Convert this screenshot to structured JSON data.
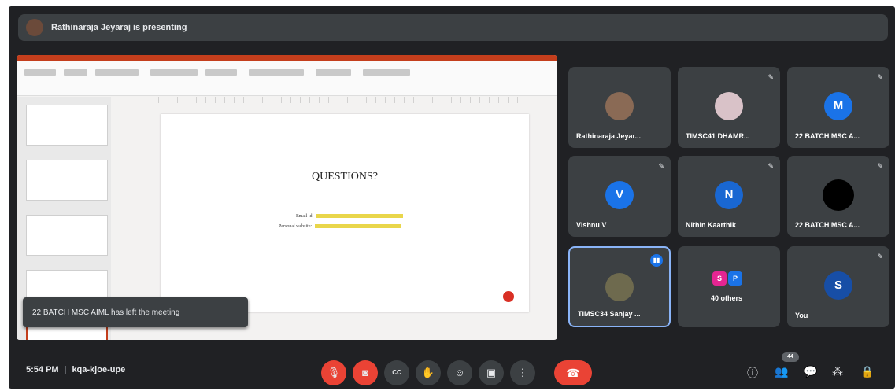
{
  "banner": {
    "text": "Rathinaraja Jeyaraj is presenting"
  },
  "presentation": {
    "slide_title": "QUESTIONS?",
    "line1_label": "Email id:",
    "line2_label": "Personal website:"
  },
  "toast": {
    "text": "22 BATCH MSC AIML has left the meeting"
  },
  "tiles": [
    {
      "name": "Rathinaraja Jeyar...",
      "avatar": "photo",
      "mic": ""
    },
    {
      "name": "TIMSC41 DHAMR...",
      "avatar": "photo",
      "mic": "muted-mic-icon"
    },
    {
      "name": "22 BATCH MSC A...",
      "avatar": "M",
      "color": "#1a73e8",
      "mic": "muted-mic-icon"
    },
    {
      "name": "Vishnu V",
      "avatar": "V",
      "color": "#1a73e8",
      "mic": "muted-mic-icon"
    },
    {
      "name": "Nithin Kaarthik",
      "avatar": "N",
      "color": "#1967d2",
      "mic": "muted-mic-icon"
    },
    {
      "name": "22 BATCH MSC A...",
      "avatar": "dark",
      "color": "#000000",
      "mic": "muted-mic-icon"
    },
    {
      "name": "TIMSC34 Sanjay ...",
      "avatar": "photo",
      "mic": "speaking-icon",
      "active": true
    },
    {
      "name": "40 others",
      "avatar": "S P",
      "mic": ""
    },
    {
      "name": "You",
      "avatar": "S",
      "color": "#174ea6",
      "mic": "muted-mic-icon"
    }
  ],
  "others_avatars": [
    {
      "letter": "S",
      "color": "#e52592"
    },
    {
      "letter": "P",
      "color": "#1a73e8"
    }
  ],
  "bottom": {
    "time": "5:54 PM",
    "meeting_code": "kqa-kjoe-upe",
    "people_count": "44"
  },
  "controls": {
    "mic": "mic-off-icon",
    "camera": "camera-off-icon",
    "captions": "CC",
    "raise_hand": "✋",
    "emoji": "☺",
    "present": "▣",
    "more": "⋮",
    "leave": "☎"
  }
}
